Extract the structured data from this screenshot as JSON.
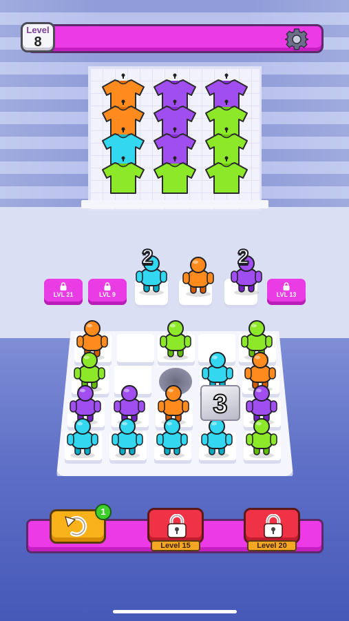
{
  "header": {
    "level_label": "Level",
    "level_number": "8",
    "settings_icon": "gear-icon"
  },
  "rack": {
    "shirts": [
      [
        "#ff8a1e",
        "#a04ef0",
        "#a04ef0"
      ],
      [
        "#ff8a1e",
        "#a04ef0",
        "#8ee82a"
      ],
      [
        "#33d8f0",
        "#a04ef0",
        "#8ee82a"
      ],
      [
        "#8ee82a",
        "#8ee82a",
        "#8ee82a"
      ]
    ]
  },
  "queue": {
    "locked_slots": [
      "LVL 21",
      "LVL 9",
      "LVL 13"
    ],
    "slot_counts": [
      "2",
      "2"
    ],
    "slot_people": [
      "#33d8f0",
      "#ff8a1e",
      "#a04ef0"
    ]
  },
  "board": {
    "mystery_count": "3",
    "rows": [
      [
        "#ff8a1e",
        "",
        "#8ee82a",
        "",
        "#8ee82a"
      ],
      [
        "#8ee82a",
        "",
        "",
        "#33d8f0",
        "#ff8a1e"
      ],
      [
        "#a04ef0",
        "#a04ef0",
        "#ff8a1e",
        "",
        "#a04ef0"
      ],
      [
        "#33d8f0",
        "#33d8f0",
        "#33d8f0",
        "#33d8f0",
        "#8ee82a"
      ]
    ]
  },
  "footer": {
    "undo_icon": "undo-icon",
    "undo_count": "1",
    "locked_boosters": [
      "Level 15",
      "Level 20"
    ]
  },
  "colors": {
    "orange": "#ff8a1e",
    "purple": "#a04ef0",
    "green": "#8ee82a",
    "cyan": "#33d8f0",
    "bar_magenta": "#ec3ae6"
  }
}
